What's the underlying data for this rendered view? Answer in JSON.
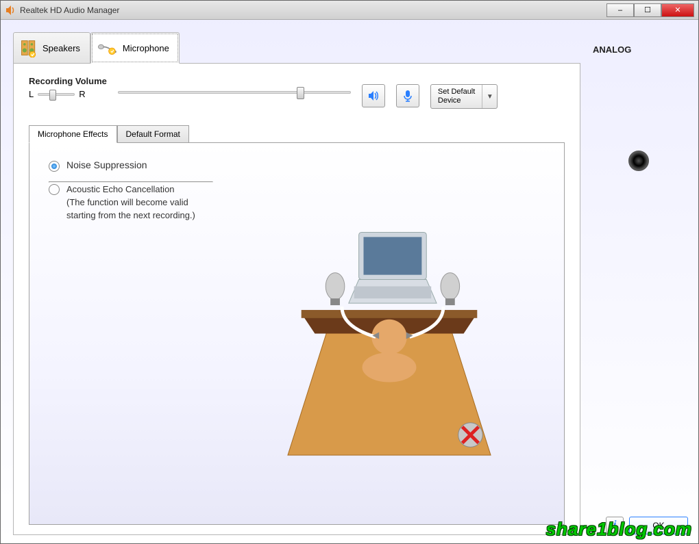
{
  "window": {
    "title": "Realtek HD Audio Manager"
  },
  "tabs": {
    "speakers": "Speakers",
    "microphone": "Microphone"
  },
  "recording": {
    "title": "Recording Volume",
    "left": "L",
    "right": "R",
    "set_default": "Set Default\nDevice"
  },
  "subtabs": {
    "effects": "Microphone Effects",
    "format": "Default Format"
  },
  "options": {
    "noise": "Noise Suppression",
    "echo_title": "Acoustic Echo Cancellation",
    "echo_desc": "(The function will become valid starting from the next recording.)"
  },
  "side": {
    "title": "ANALOG"
  },
  "footer": {
    "ok": "OK",
    "info": "i"
  },
  "watermark": "share1blog.com"
}
